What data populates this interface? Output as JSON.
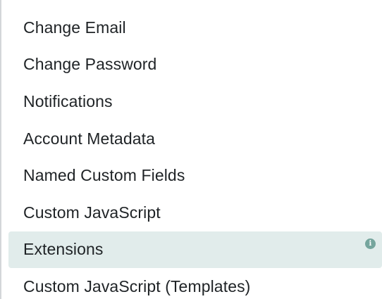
{
  "menu": {
    "items": [
      {
        "label": "Change Email"
      },
      {
        "label": "Change Password"
      },
      {
        "label": "Notifications"
      },
      {
        "label": "Account Metadata"
      },
      {
        "label": "Named Custom Fields"
      },
      {
        "label": "Custom JavaScript"
      },
      {
        "label": "Extensions",
        "active": true,
        "info_icon": "i"
      },
      {
        "label": "Custom JavaScript (Templates)"
      }
    ]
  },
  "colors": {
    "active_background": "#e1eceb",
    "info_icon": "#75a59d",
    "rail": "#d3d6d9",
    "text": "#1f2326"
  },
  "icons": {
    "info": "info-icon"
  }
}
